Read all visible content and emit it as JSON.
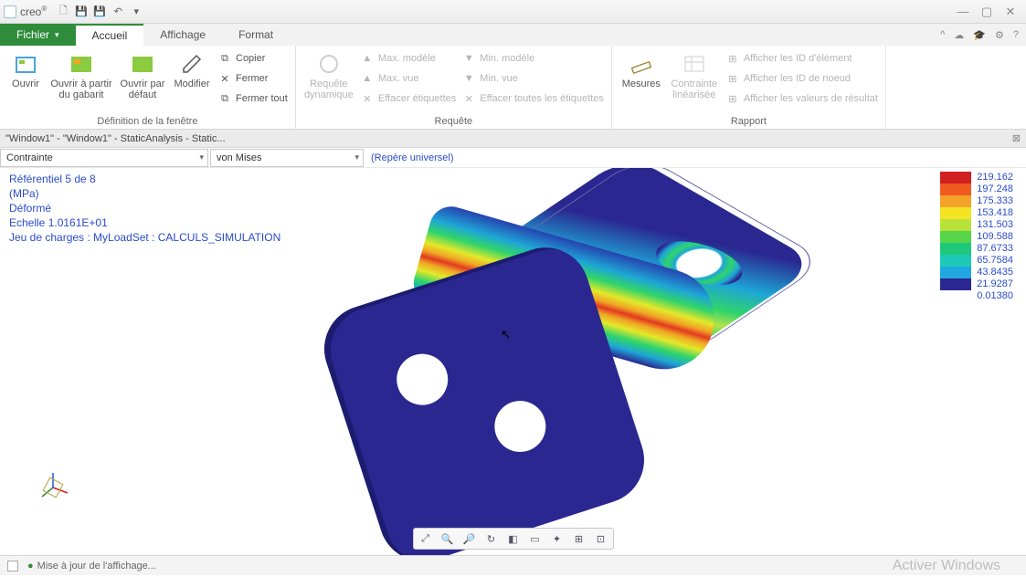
{
  "app": {
    "name": "creo",
    "window_title_suffix": "®"
  },
  "tabs": {
    "file": "Fichier",
    "home": "Accueil",
    "display": "Affichage",
    "format": "Format"
  },
  "ribbon": {
    "group_window": {
      "label": "Définition de la fenêtre",
      "open": "Ouvrir",
      "open_template": "Ouvrir à partir\ndu gabarit",
      "open_default": "Ouvrir par\ndéfaut",
      "modify": "Modifier",
      "copy": "Copier",
      "close": "Fermer",
      "close_all": "Fermer tout"
    },
    "group_query": {
      "label": "Requête",
      "dynamic_query": "Requête\ndynamique",
      "max_model": "Max. modèle",
      "max_view": "Max. vue",
      "min_model": "Min. modèle",
      "min_view": "Min. vue",
      "clear_tags": "Effacer étiquettes",
      "clear_all_tags": "Effacer toutes les étiquettes"
    },
    "group_report": {
      "label": "Rapport",
      "measures": "Mesures",
      "linear_constraint": "Contrainte\nlinéarisée",
      "show_elem_ids": "Afficher les ID d'élément",
      "show_node_ids": "Afficher les ID de noeud",
      "show_result_vals": "Afficher les valeurs de résultat"
    }
  },
  "doc_title": "\"Window1\" - \"Window1\" - StaticAnalysis - Static...",
  "selectors": {
    "quantity": "Contrainte",
    "component": "von Mises",
    "frame": "(Repère universel)"
  },
  "info": {
    "ref": "Référentiel 5 de 8",
    "unit": "(MPa)",
    "deformed": "Déformé",
    "scale": "Echelle  1.0161E+01",
    "loadset": "Jeu de charges : MyLoadSet :  CALCULS_SIMULATION"
  },
  "legend": {
    "values": [
      "219.162",
      "197.248",
      "175.333",
      "153.418",
      "131.503",
      "109.588",
      "87.6733",
      "65.7584",
      "43.8435",
      "21.9287",
      "0.01380"
    ],
    "colors": [
      "#d21f1f",
      "#ef5a1e",
      "#f2a328",
      "#f4e423",
      "#b7e23a",
      "#57d549",
      "#1dc87a",
      "#1ccab7",
      "#22a8e0",
      "#2a2790"
    ]
  },
  "status": {
    "msg": "Mise à jour de l'affichage...",
    "watermark": "Activer Windows",
    "watermark_sub": ""
  }
}
